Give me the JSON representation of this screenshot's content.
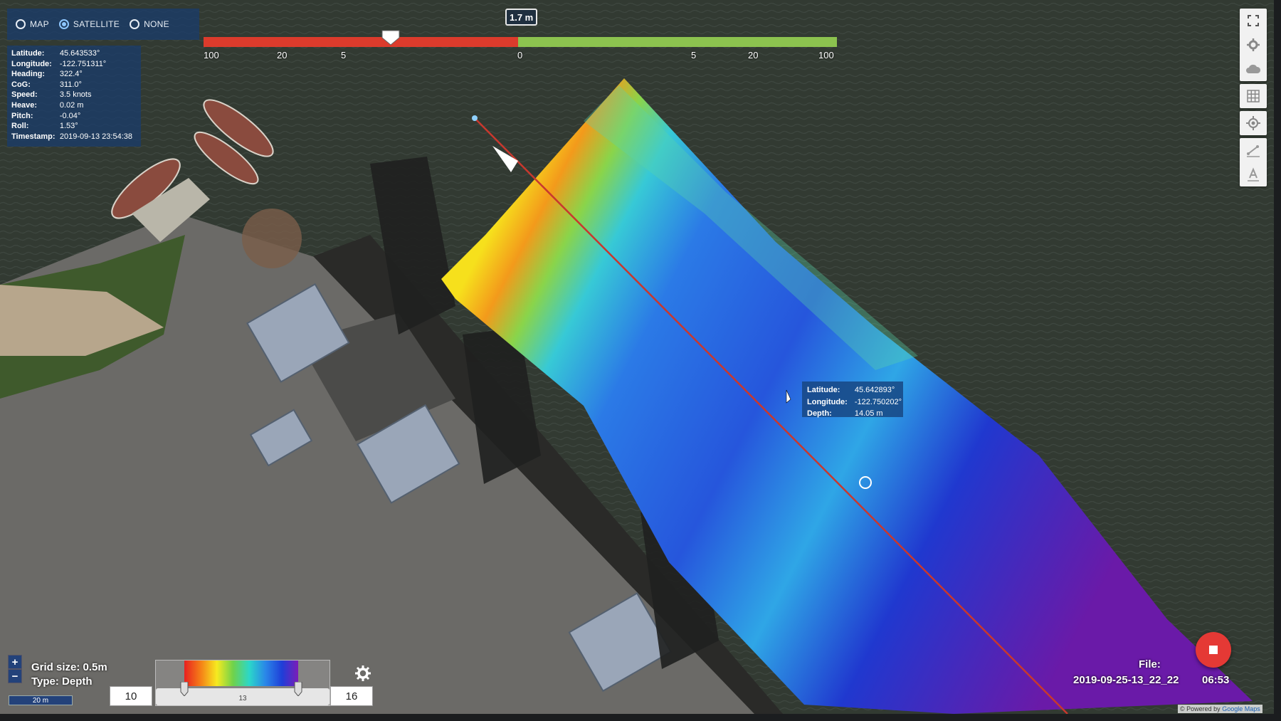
{
  "view_mode": {
    "options": [
      {
        "label": "MAP",
        "selected": false
      },
      {
        "label": "SATELLITE",
        "selected": true
      },
      {
        "label": "NONE",
        "selected": false
      }
    ]
  },
  "nav_info": [
    {
      "label": "Latitude:",
      "value": "45.643533°"
    },
    {
      "label": "Longitude:",
      "value": "-122.751311°"
    },
    {
      "label": "Heading:",
      "value": "322.4°"
    },
    {
      "label": "CoG:",
      "value": "311.0°"
    },
    {
      "label": "Speed:",
      "value": "3.5 knots"
    },
    {
      "label": "Heave:",
      "value": "0.02 m"
    },
    {
      "label": "Pitch:",
      "value": "-0.04°"
    },
    {
      "label": "Roll:",
      "value": "1.53°"
    },
    {
      "label": "Timestamp:",
      "value": "2019-09-13 23:54:38"
    }
  ],
  "depth_scale": {
    "current_value": "1.7 m",
    "ticks_left": [
      "100",
      "20",
      "5",
      "0"
    ],
    "ticks_right": [
      "5",
      "20",
      "100"
    ],
    "colors": {
      "negative": "#dc3b2c",
      "positive": "#8cc34f"
    }
  },
  "toolbar": {
    "icons": [
      "fullscreen-icon",
      "settings-icon",
      "cloud-icon",
      "grid-icon",
      "locate-icon",
      "measure-icon",
      "text-icon"
    ]
  },
  "tooltip": {
    "latitude_label": "Latitude:",
    "latitude": "45.642893°",
    "longitude_label": "Longitude:",
    "longitude": "-122.750202°",
    "depth_label": "Depth:",
    "depth": "14.05 m"
  },
  "zoom": {
    "in": "+",
    "out": "−"
  },
  "grid": {
    "size_text": "Grid size: 0.5m",
    "type_text": "Type: Depth"
  },
  "distance_scale": "20 m",
  "color_range": {
    "min": "10",
    "max": "16",
    "mid": "13"
  },
  "file": {
    "label": "File:",
    "name": "2019-09-25-13_22_22",
    "time": "06:53"
  },
  "attribution": {
    "prefix": "© Powered by",
    "provider": "Google Maps"
  }
}
